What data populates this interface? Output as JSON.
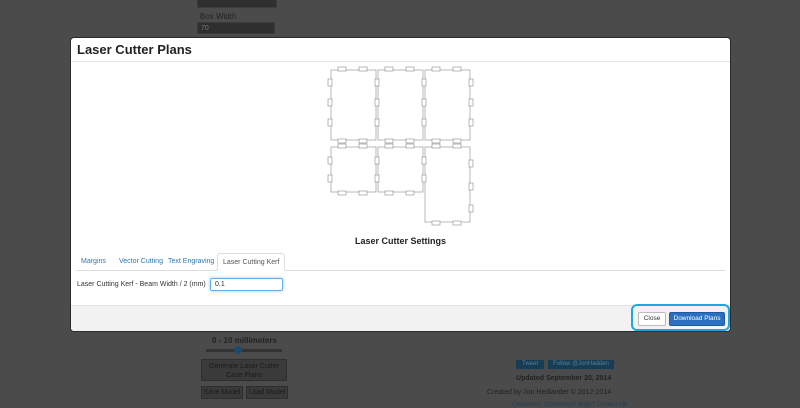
{
  "background": {
    "box_width_label": "Box Width",
    "box_width_value": "70",
    "range_label": "0 - 10 millimeters",
    "generate_button": "Generate Laser Cutter Case Plans",
    "save_button": "Save Model",
    "load_button": "Load Model",
    "tweet_button": "Tweet",
    "follow_button": "Follow @JonHadden",
    "updated": "Updated September 20, 2014",
    "created_by": "Created by Jon Hedlander © 2012-2014",
    "footer_links": "Questions? Comments? Bugs? Contact Me"
  },
  "modal": {
    "title": "Laser Cutter Plans",
    "settings_title": "Laser Cutter Settings",
    "tabs": [
      {
        "label": "Margins"
      },
      {
        "label": "Vector Cutting"
      },
      {
        "label": "Text Engraving"
      },
      {
        "label": "Laser Cutting Kerf"
      }
    ],
    "active_tab": "Laser Cutting Kerf",
    "kerf_label": "Laser Cutting Kerf - Beam Width / 2 (mm)",
    "kerf_value": "0.1",
    "close_button": "Close",
    "download_button": "Download Plans"
  },
  "colors": {
    "accent": "#2a6fc0",
    "link": "#2a7ab0",
    "highlight": "#1ca7e0"
  }
}
